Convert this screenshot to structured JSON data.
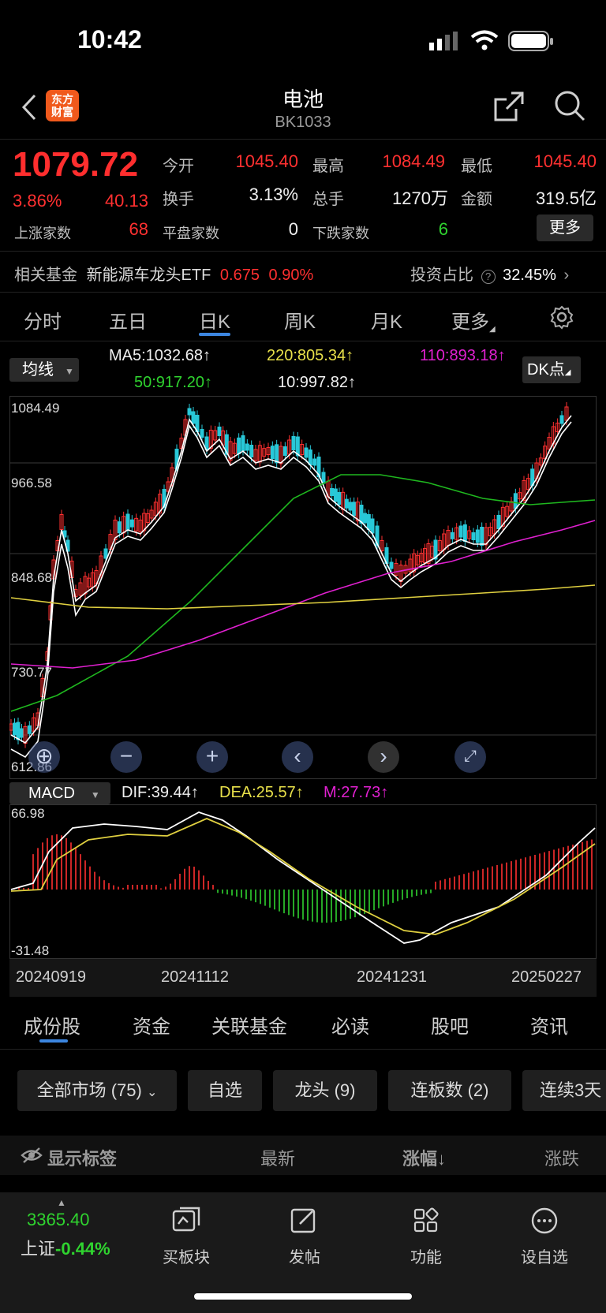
{
  "status": {
    "time": "10:42"
  },
  "header": {
    "logo_text": "东方\n财富",
    "title": "电池",
    "code": "BK1033"
  },
  "quote": {
    "price": "1079.72",
    "change_pct": "3.86%",
    "change": "40.13",
    "open_label": "今开",
    "open": "1045.40",
    "high_label": "最高",
    "high": "1084.49",
    "low_label": "最低",
    "low": "1045.40",
    "turnover_label": "换手",
    "turnover": "3.13%",
    "volume_label": "总手",
    "volume": "1270万",
    "amount_label": "金额",
    "amount": "319.5亿",
    "up_label": "上涨家数",
    "up": "68",
    "flat_label": "平盘家数",
    "flat": "0",
    "down_label": "下跌家数",
    "down": "6",
    "more_label": "更多"
  },
  "fund": {
    "label": "相关基金",
    "name": "新能源车龙头ETF",
    "price": "0.675",
    "pct": "0.90%",
    "invest_label": "投资占比",
    "invest_pct": "32.45%"
  },
  "period_tabs": [
    "分时",
    "五日",
    "日K",
    "周K",
    "月K",
    "更多"
  ],
  "ma_legend": {
    "select": "均线",
    "ma5": "MA5:1032.68↑",
    "ma220": "220:805.34↑",
    "ma110": "110:893.18↑",
    "ma50": "50:917.20↑",
    "ma10": "10:997.82↑",
    "dk": "DK点"
  },
  "kchart": {
    "y_ticks": [
      "1084.49",
      "966.58",
      "848.68",
      "730.77",
      "612.86"
    ]
  },
  "macd": {
    "select": "MACD",
    "dif": "DIF:39.44↑",
    "dea": "DEA:25.57↑",
    "m": "M:27.73↑",
    "y_top": "66.98",
    "y_bottom": "-31.48"
  },
  "dates": [
    "20240919",
    "20241112",
    "20241231",
    "20250227"
  ],
  "bottom_tabs": [
    "成份股",
    "资金",
    "关联基金",
    "必读",
    "股吧",
    "资讯"
  ],
  "chips": [
    "全部市场 (75)",
    "自选",
    "龙头 (9)",
    "连板数 (2)",
    "连续3天"
  ],
  "list_header": {
    "tags": "显示标签",
    "latest": "最新",
    "change": "涨幅↓",
    "change_amt": "涨跌"
  },
  "nav": {
    "index_value": "3365.40",
    "index_name": "上证",
    "index_pct": "-0.44%",
    "items": [
      "买板块",
      "发帖",
      "功能",
      "设自选"
    ]
  },
  "colors": {
    "up": "#ff3030",
    "down": "#2fd32f",
    "accent": "#3c86e0",
    "ma5": "#ffffff",
    "ma10": "#ffffff",
    "ma50": "#1fb81f",
    "ma110": "#e020d0",
    "ma220": "#e0d040"
  }
}
